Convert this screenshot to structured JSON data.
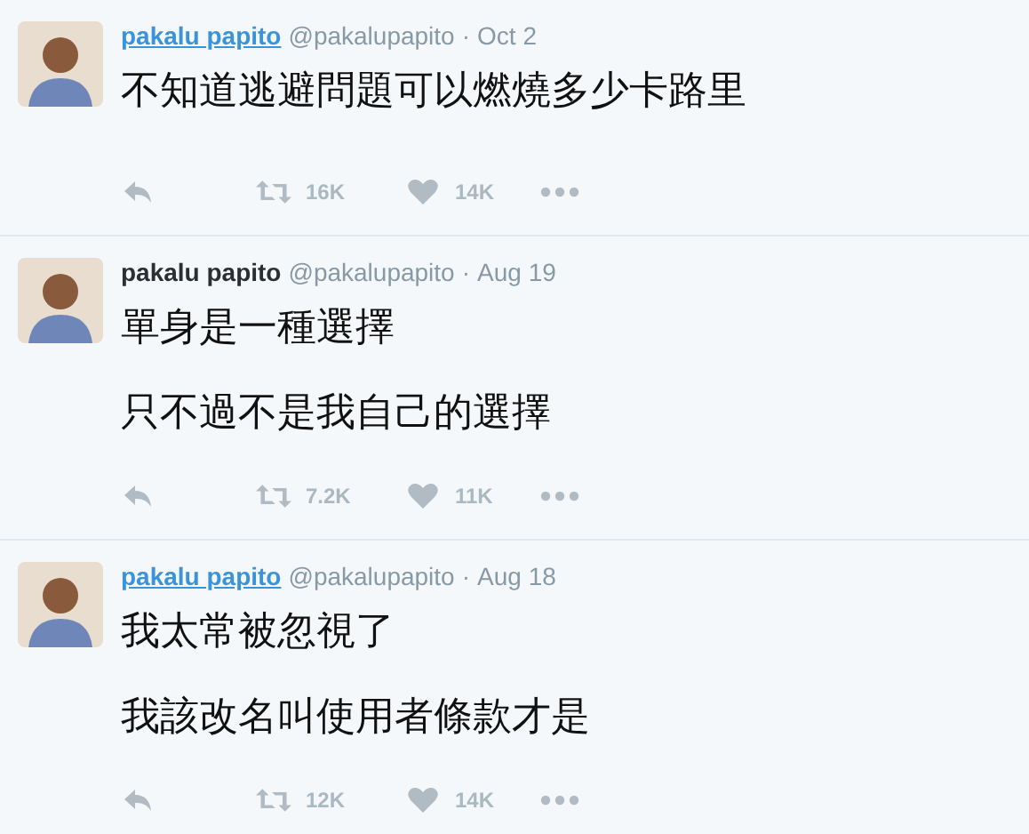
{
  "tweets": [
    {
      "name": "pakalu papito",
      "handle": "@pakalupapito",
      "separator": "·",
      "date": "Oct 2",
      "name_hovered": true,
      "paragraphs": [
        "不知道逃避問題可以燃燒多少卡路里"
      ],
      "retweets": "16K",
      "likes": "14K"
    },
    {
      "name": "pakalu papito",
      "handle": "@pakalupapito",
      "separator": "·",
      "date": "Aug 19",
      "name_hovered": false,
      "paragraphs": [
        "單身是一種選擇",
        "只不過不是我自己的選擇"
      ],
      "retweets": "7.2K",
      "likes": "11K"
    },
    {
      "name": "pakalu papito",
      "handle": "@pakalupapito",
      "separator": "·",
      "date": "Aug 18",
      "name_hovered": true,
      "paragraphs": [
        "我太常被忽視了",
        "我該改名叫使用者條款才是"
      ],
      "retweets": "12K",
      "likes": "14K"
    }
  ]
}
